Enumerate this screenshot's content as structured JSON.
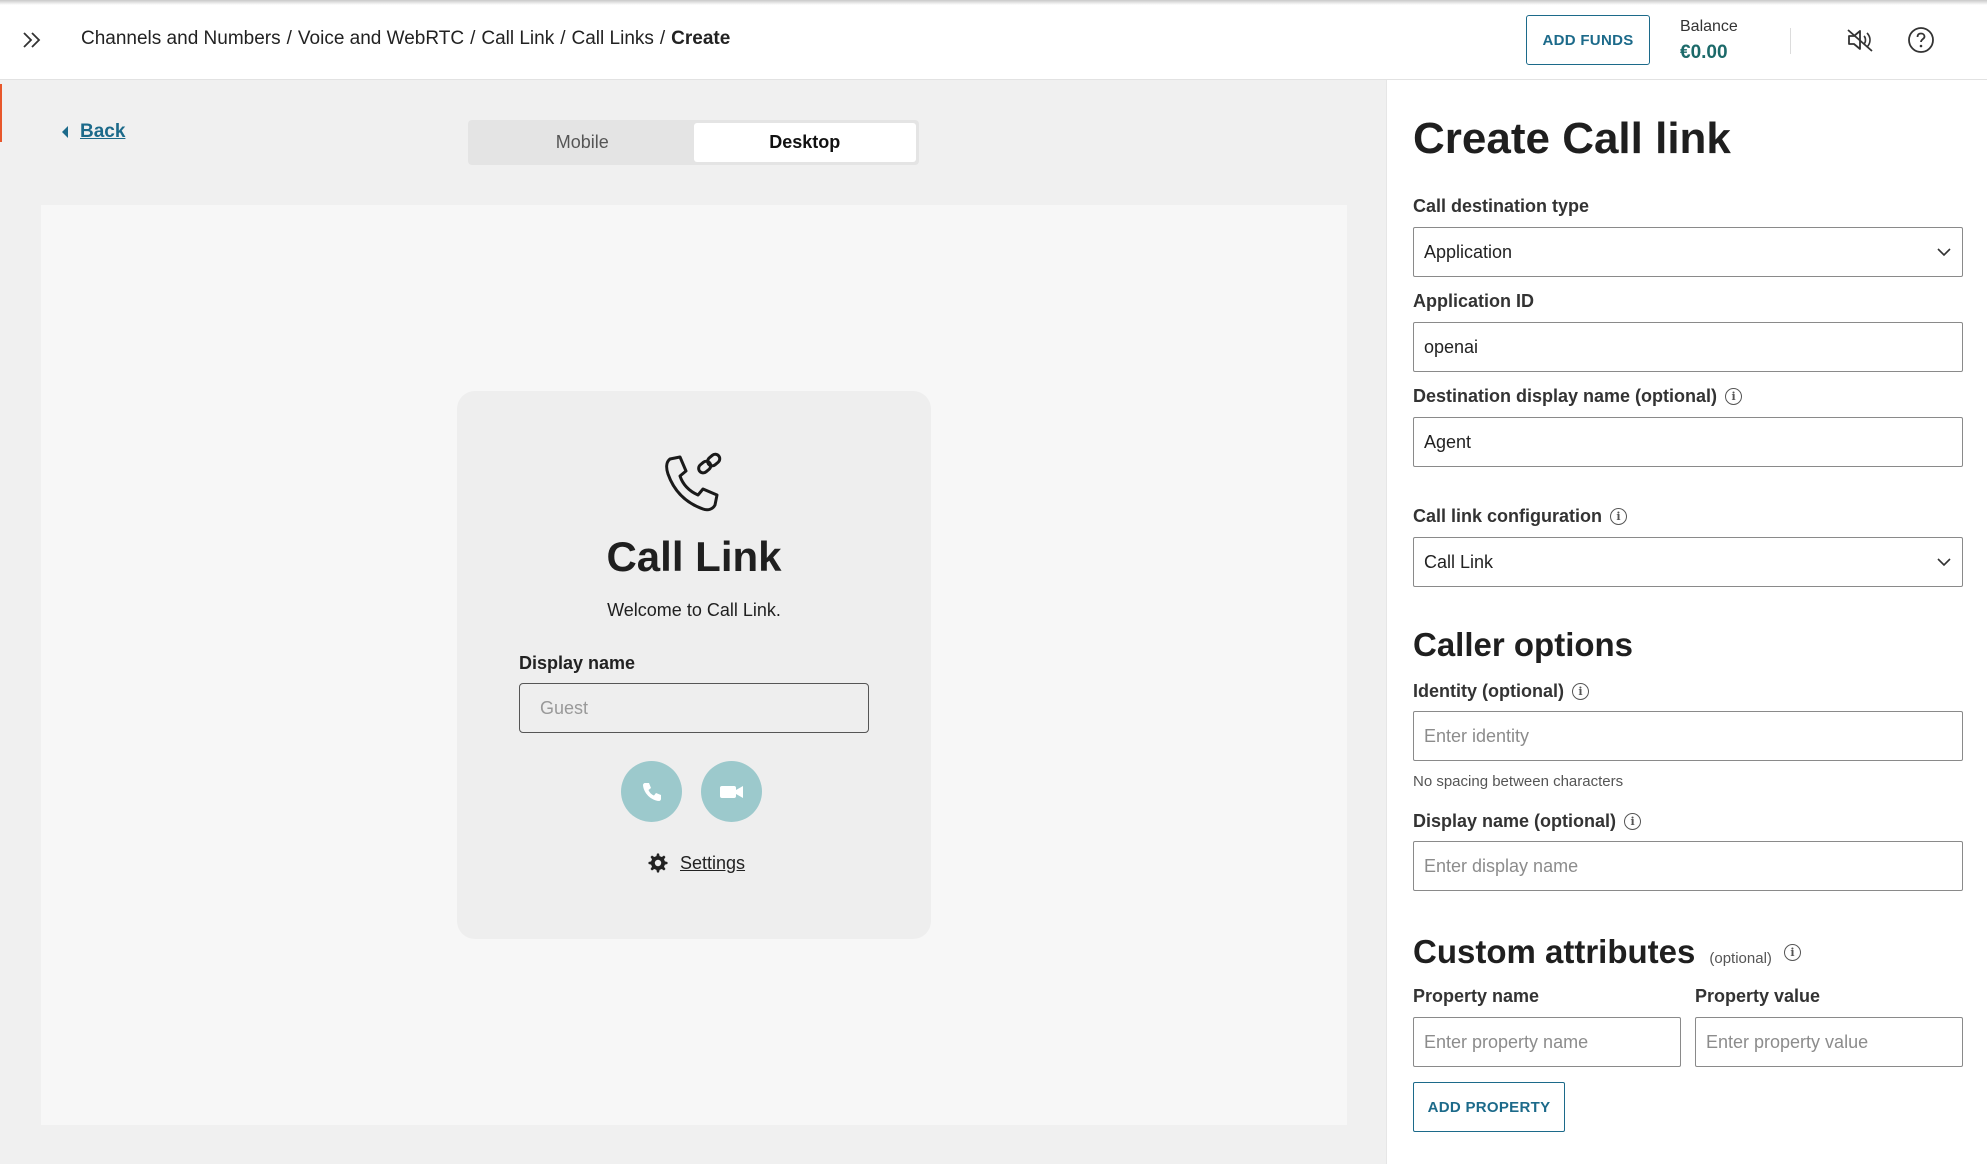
{
  "header": {
    "breadcrumb": [
      "Channels and Numbers",
      "Voice and WebRTC",
      "Call Link",
      "Call Links"
    ],
    "breadcrumb_current": "Create",
    "separator": "/",
    "add_funds_label": "ADD FUNDS",
    "balance_label": "Balance",
    "balance_value": "€0.00",
    "icons": [
      "expand-icon",
      "sound-off-icon",
      "help-icon"
    ]
  },
  "preview": {
    "back_label": "Back",
    "device_options": [
      "Mobile",
      "Desktop"
    ],
    "device_selected": "Desktop",
    "card": {
      "title": "Call Link",
      "welcome": "Welcome to Call Link.",
      "display_name_label": "Display name",
      "display_name_placeholder": "Guest",
      "settings_label": "Settings"
    },
    "accent_color": "#9cc9cc"
  },
  "form": {
    "title": "Create Call link",
    "destination_type": {
      "label": "Call destination type",
      "value": "Application"
    },
    "application_id": {
      "label": "Application ID",
      "value": "openai"
    },
    "destination_display_name": {
      "label": "Destination display name (optional)",
      "value": "Agent"
    },
    "config": {
      "label": "Call link configuration",
      "value": "Call Link"
    },
    "caller_options": {
      "title": "Caller options",
      "identity": {
        "label": "Identity (optional)",
        "placeholder": "Enter identity",
        "hint": "No spacing between characters"
      },
      "display_name": {
        "label": "Display name (optional)",
        "placeholder": "Enter display name"
      }
    },
    "custom_attributes": {
      "title": "Custom attributes",
      "optional_tag": "(optional)",
      "property_name": {
        "label": "Property name",
        "placeholder": "Enter property name"
      },
      "property_value": {
        "label": "Property value",
        "placeholder": "Enter property value"
      },
      "add_property_label": "ADD PROPERTY"
    }
  },
  "colors": {
    "brand": "#1c6a8a",
    "balance": "#1c6a6a",
    "accent_bar": "#e8572b"
  }
}
